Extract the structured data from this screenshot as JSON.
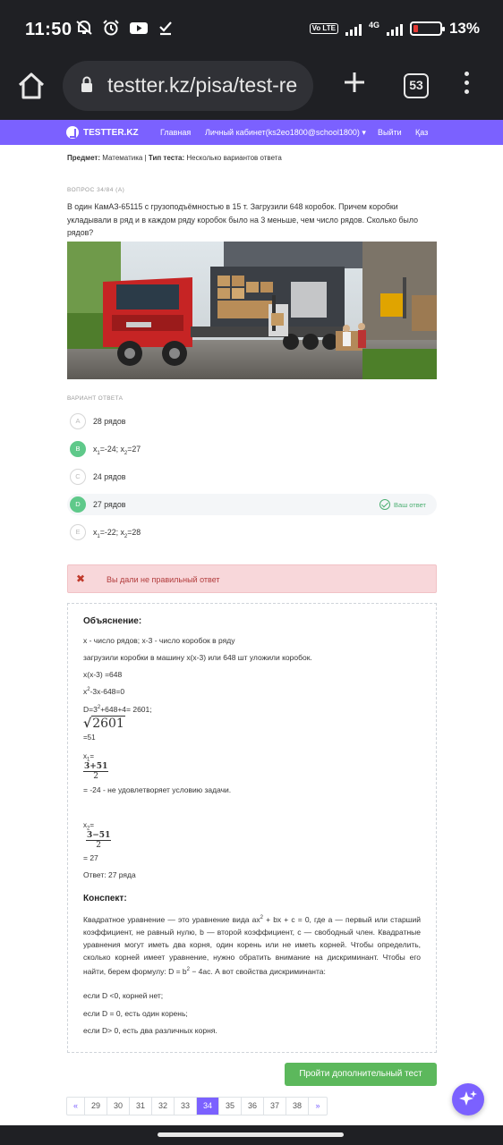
{
  "status_bar": {
    "time": "11:50",
    "volte": "Vo LTE",
    "network": "4G",
    "battery": "13%",
    "battery_level": 0.13
  },
  "browser": {
    "url": "testter.kz/pisa/test-re",
    "tab_count": "53"
  },
  "site_nav": {
    "brand": "TESTTER.KZ",
    "items": [
      "Главная",
      "Личный кабинет(ks2eo1800@school1800) ▾",
      "Выйти",
      "Қаз"
    ]
  },
  "meta": {
    "subject_label": "Предмет:",
    "subject": "Математика",
    "separator": " | ",
    "test_type_label": "Тип теста:",
    "test_type": "Несколько вариантов ответа"
  },
  "question": {
    "number": "ВОПРОС 34/84 (A)",
    "text": "В один КамАЗ-65115 с грузоподъёмностью в 15 т. Загрузили 648 коробок. Причем коробки укладывали в ряд и в каждом ряду коробок было на 3 меньше, чем число рядов. Сколько было рядов?"
  },
  "answers": {
    "label": "ВАРИАНТ ОТВЕТА",
    "your_answer": "Ваш ответ",
    "options": [
      {
        "letter": "A",
        "text": "28 рядов"
      },
      {
        "letter": "B",
        "text_a": "x",
        "sub_a": "1",
        "mid": "=-24; x",
        "sub_b": "2",
        "end": "=27"
      },
      {
        "letter": "C",
        "text": "24 рядов"
      },
      {
        "letter": "D",
        "text": "27 рядов"
      },
      {
        "letter": "E",
        "text_a": "x",
        "sub_a": "1",
        "mid": "=-22; x",
        "sub_b": "2",
        "end": "=28"
      }
    ]
  },
  "alert": {
    "icon": "✖",
    "text": "Вы дали не правильный ответ"
  },
  "explanation": {
    "heading": "Объяснение:",
    "line1": "x - число рядов; x-3 - число коробок в ряду",
    "line2": "загрузили коробки в машину x(x-3) или 648 шт уложили коробок.",
    "line3": "x(x-3) =648",
    "line4_a": "x",
    "line4_sup": "2",
    "line4_b": "-3x-648=0",
    "line5_a": "D=3",
    "line5_sup": "2",
    "line5_b": "+648+4= 2601;",
    "sqrt_sign": "√",
    "sqrt_value": "2601",
    "sqrt_result": "=51",
    "x1_a": "x",
    "x1_sub": "1",
    "x1_b": "=",
    "frac1_num": "3+51",
    "frac1_den": "2",
    "x1_result": "= -24 - не удовлетворяет условию задачи.",
    "x2_a": "x",
    "x2_sub": "2",
    "x2_b": "=",
    "frac2_num": "3−51",
    "frac2_den": "2",
    "x2_result": "= 27",
    "answer": "Ответ: 27 ряда"
  },
  "konspekt": {
    "heading": "Конспект:",
    "p1_a": "Квадратное уравнение — это уравнение вида ax",
    "p1_sup1": "2",
    "p1_b": " + bx + c = 0, где a — первый или старший коэффициент, не равный нулю, b — второй коэффициент, c — свободный член. Квадратные уравнения могут иметь два корня, один корень или не иметь корней. Чтобы определить, сколько корней имеет уравнение, нужно обратить внимание на дискриминант. Чтобы его найти, берем формулу: D = b",
    "p1_sup2": "2",
    "p1_c": " − 4ac. А вот свойства дискриминанта:",
    "item1": "если D <0, корней нет;",
    "item2": "если D = 0, есть один корень;",
    "item3": "если D> 0, есть два различных корня."
  },
  "extra_button": "Пройти дополнительный тест",
  "pagination": {
    "prev": "«",
    "pages": [
      "29",
      "30",
      "31",
      "32",
      "33",
      "34",
      "35",
      "36",
      "37",
      "38"
    ],
    "next": "»"
  },
  "colors": {
    "brand": "#7b61ff",
    "correct": "#5fc98a",
    "alert_bg": "#f8d7da",
    "button_green": "#5cb85c"
  }
}
